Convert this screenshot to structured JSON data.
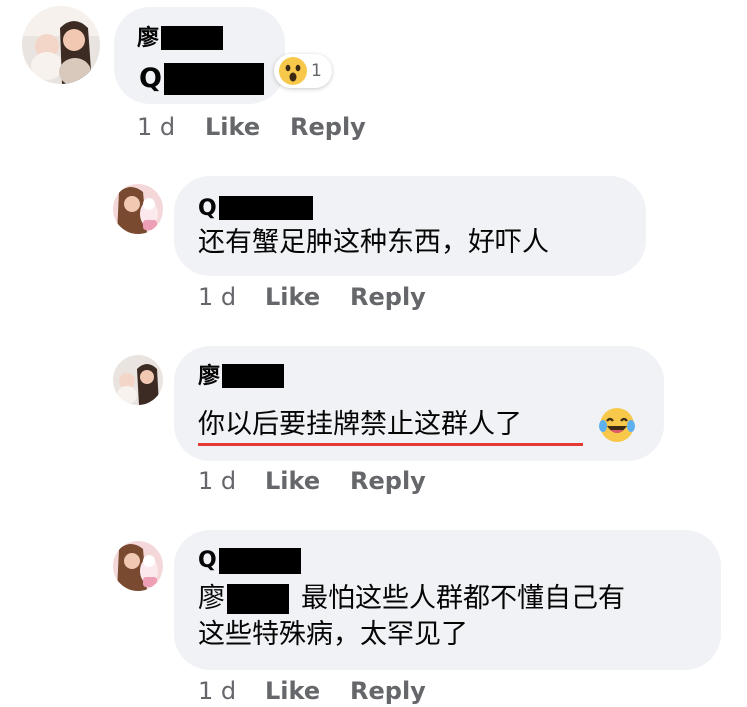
{
  "comments": [
    {
      "author_prefix": "廖",
      "text_prefix": "Q",
      "reaction": {
        "icon": "wow-emoji-icon",
        "count": "1"
      },
      "actions": {
        "time": "1 d",
        "like": "Like",
        "reply": "Reply"
      }
    },
    {
      "author_prefix": "Q",
      "text": "还有蟹足肿这种东西，好吓人",
      "actions": {
        "time": "1 d",
        "like": "Like",
        "reply": "Reply"
      }
    },
    {
      "author_prefix": "廖",
      "text": "你以后要挂牌禁止这群人了",
      "emoji": "laughing-tears-emoji-icon",
      "actions": {
        "time": "1 d",
        "like": "Like",
        "reply": "Reply"
      }
    },
    {
      "author_prefix": "Q",
      "mention_prefix": "廖",
      "line1": "最怕这些人群都不懂自己有",
      "line2": "这些特殊病，太罕见了",
      "actions": {
        "time": "1 d",
        "like": "Like",
        "reply": "Reply"
      }
    }
  ],
  "colors": {
    "bubble": "#f0f2f5",
    "meta": "#65676b",
    "underline": "#e53935"
  }
}
